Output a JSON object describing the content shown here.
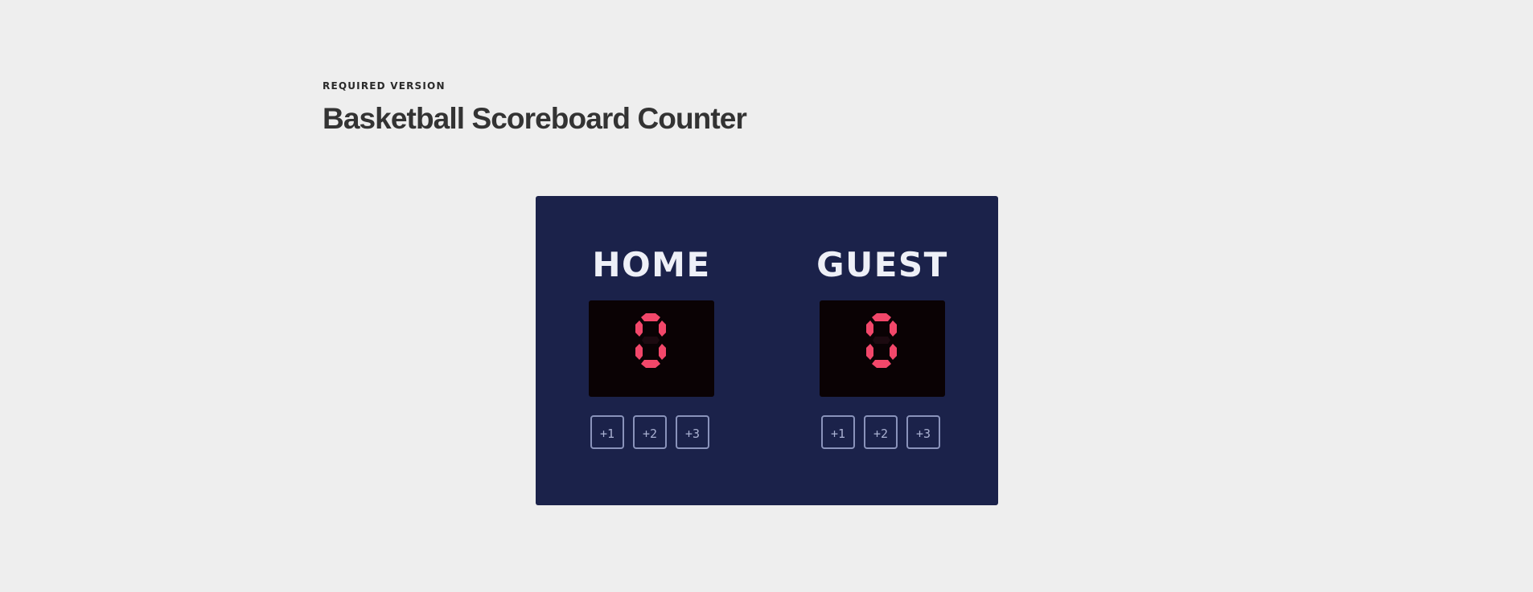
{
  "header": {
    "eyebrow": "REQUIRED VERSION",
    "title": "Basketball Scoreboard Counter"
  },
  "scoreboard": {
    "colors": {
      "board_background": "#1b224a",
      "display_background": "#0a0204",
      "digit_lit": "#f2476a",
      "button_border": "#8a93bb",
      "team_name": "#eef0f7"
    },
    "teams": [
      {
        "name": "HOME",
        "score": 0,
        "buttons": [
          "+1",
          "+2",
          "+3"
        ]
      },
      {
        "name": "GUEST",
        "score": 0,
        "buttons": [
          "+1",
          "+2",
          "+3"
        ]
      }
    ]
  }
}
